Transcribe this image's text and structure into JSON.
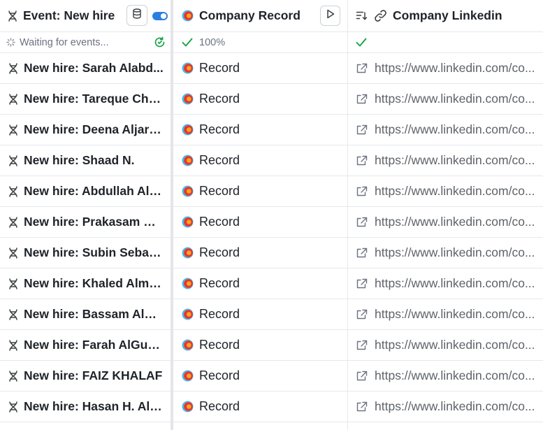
{
  "event_column": {
    "header": "Event: New hire",
    "status": "Waiting for events...",
    "icons": {
      "trigger": "dna-icon",
      "database": "database-icon",
      "toggle": "toggle-on-icon",
      "refresh": "refresh-icon"
    }
  },
  "company_column": {
    "header": "Company Record",
    "status": "100%",
    "icons": {
      "company": "company-logo-icon",
      "run": "play-icon",
      "check": "check-icon"
    }
  },
  "linkedin_column": {
    "header": "Company Linkedin",
    "status": "",
    "icons": {
      "sort": "list-filter-icon",
      "link": "link-icon",
      "check": "check-icon",
      "external": "external-link-icon"
    }
  },
  "rows": [
    {
      "event": "New hire: Sarah Alabd...",
      "company": "Record",
      "linkedin": "https://www.linkedin.com/co..."
    },
    {
      "event": "New hire: Tareque Cho...",
      "company": "Record",
      "linkedin": "https://www.linkedin.com/co..."
    },
    {
      "event": "New hire: Deena Aljara...",
      "company": "Record",
      "linkedin": "https://www.linkedin.com/co..."
    },
    {
      "event": "New hire: Shaad N.",
      "company": "Record",
      "linkedin": "https://www.linkedin.com/co..."
    },
    {
      "event": "New hire: Abdullah Als...",
      "company": "Record",
      "linkedin": "https://www.linkedin.com/co..."
    },
    {
      "event": "New hire: Prakasam Ko...",
      "company": "Record",
      "linkedin": "https://www.linkedin.com/co..."
    },
    {
      "event": "New hire: Subin Sebast...",
      "company": "Record",
      "linkedin": "https://www.linkedin.com/co..."
    },
    {
      "event": "New hire: Khaled Almu...",
      "company": "Record",
      "linkedin": "https://www.linkedin.com/co..."
    },
    {
      "event": "New hire: Bassam Alm...",
      "company": "Record",
      "linkedin": "https://www.linkedin.com/co..."
    },
    {
      "event": "New hire: Farah AlGusa...",
      "company": "Record",
      "linkedin": "https://www.linkedin.com/co..."
    },
    {
      "event": "New hire: FAIZ KHALAF",
      "company": "Record",
      "linkedin": "https://www.linkedin.com/co..."
    },
    {
      "event": "New hire: Hasan H. Aln...",
      "company": "Record",
      "linkedin": "https://www.linkedin.com/co..."
    }
  ],
  "colors": {
    "accent": "#2b7fe0",
    "success": "#16a34a",
    "border": "#e6e8eb",
    "logo_red": "#e8352b",
    "logo_orange": "#f5a623",
    "logo_blue": "#4fb7e8"
  }
}
